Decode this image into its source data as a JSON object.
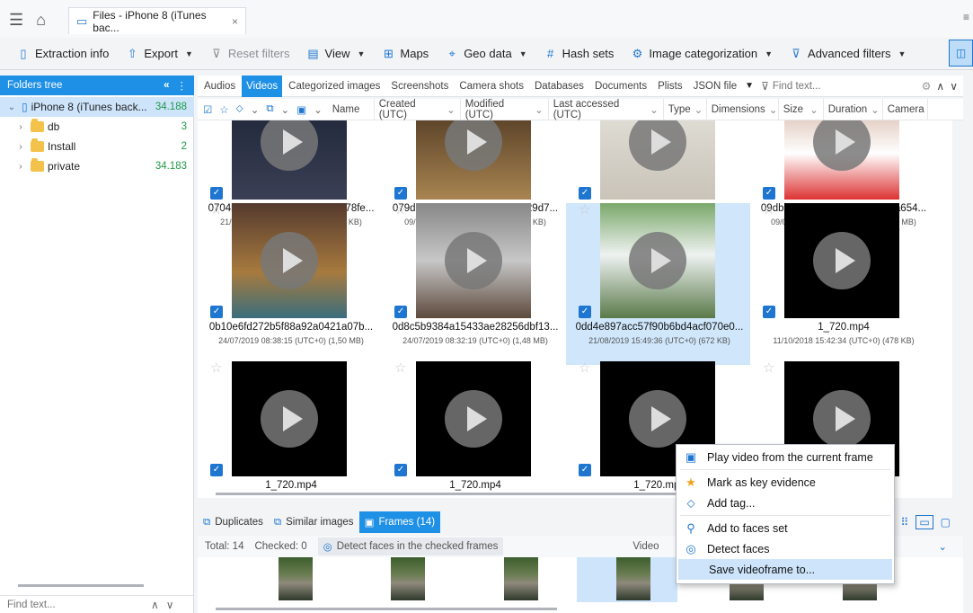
{
  "tab": {
    "title": "Files - iPhone 8 (iTunes bac...",
    "close": "×"
  },
  "toolbar": {
    "extraction_info": "Extraction info",
    "export": "Export",
    "reset_filters": "Reset filters",
    "view": "View",
    "maps": "Maps",
    "geo_data": "Geo data",
    "hash_sets": "Hash sets",
    "image_categorization": "Image categorization",
    "advanced_filters": "Advanced filters"
  },
  "folders": {
    "header": "Folders tree",
    "collapse": "«",
    "root": {
      "label": "iPhone 8 (iTunes back...",
      "count": "34.188"
    },
    "children": [
      {
        "label": "db",
        "count": "3"
      },
      {
        "label": "Install",
        "count": "2"
      },
      {
        "label": "private",
        "count": "34.183"
      }
    ],
    "find_placeholder": "Find text..."
  },
  "category_tabs": [
    "Audios",
    "Videos",
    "Categorized images",
    "Screenshots",
    "Camera shots",
    "Databases",
    "Documents",
    "Plists",
    "JSON file"
  ],
  "active_category": "Videos",
  "find_placeholder": "Find text...",
  "columns": [
    "Name",
    "Created (UTC)",
    "Modified (UTC)",
    "Last accessed (UTC)",
    "Type",
    "Dimensions",
    "Size",
    "Duration",
    "Camera"
  ],
  "rows": [
    [
      {
        "name": "0704b42b7448a1060a4e740c78fe...",
        "meta": "21/08/2019 15:49:35 (UTC+0) (669 KB)"
      },
      {
        "name": "079dc3d9-2278-4741-ada7-629d7...",
        "meta": "09/09/2019 12:05:38 (UTC+0) (766 KB)"
      },
      {
        "name": "09229899ff50d16c7f2bf71ff30061e8",
        "meta": "24/07/2019 08:38:13 (UTC+0) (391 KB)"
      },
      {
        "name": "09db01933fcc28a415b0a4b5a654...",
        "meta": "09/09/2019 12:32:30 (UTC+0) (3,03 MB)"
      }
    ],
    [
      {
        "name": "0b10e6fd272b5f88a92a0421a07b...",
        "meta": "24/07/2019 08:38:15 (UTC+0) (1,50 MB)"
      },
      {
        "name": "0d8c5b9384a15433ae28256dbf13...",
        "meta": "24/07/2019 08:32:19 (UTC+0) (1,48 MB)"
      },
      {
        "name": "0dd4e897acc57f90b6bd4acf070e0...",
        "meta": "21/08/2019 15:49:36 (UTC+0) (672 KB)"
      },
      {
        "name": "1_720.mp4",
        "meta": "11/10/2018 15:42:34 (UTC+0) (478 KB)"
      }
    ],
    [
      {
        "name": "1_720.mp4",
        "meta": ""
      },
      {
        "name": "1_720.mp4",
        "meta": ""
      },
      {
        "name": "1_720.mp4",
        "meta": ""
      },
      {
        "name": "",
        "meta": ""
      }
    ]
  ],
  "bottom_tabs": {
    "duplicates": "Duplicates",
    "similar": "Similar images",
    "frames": "Frames (14)"
  },
  "frames_bar": {
    "total": "Total: 14",
    "checked": "Checked: 0",
    "detect": "Detect faces in the checked frames",
    "video": "Video"
  },
  "context_menu": {
    "play": "Play video from the current frame",
    "mark": "Mark as key evidence",
    "add_tag": "Add tag...",
    "add_faces": "Add to faces set",
    "detect_faces": "Detect faces",
    "save_frame": "Save videoframe to..."
  }
}
